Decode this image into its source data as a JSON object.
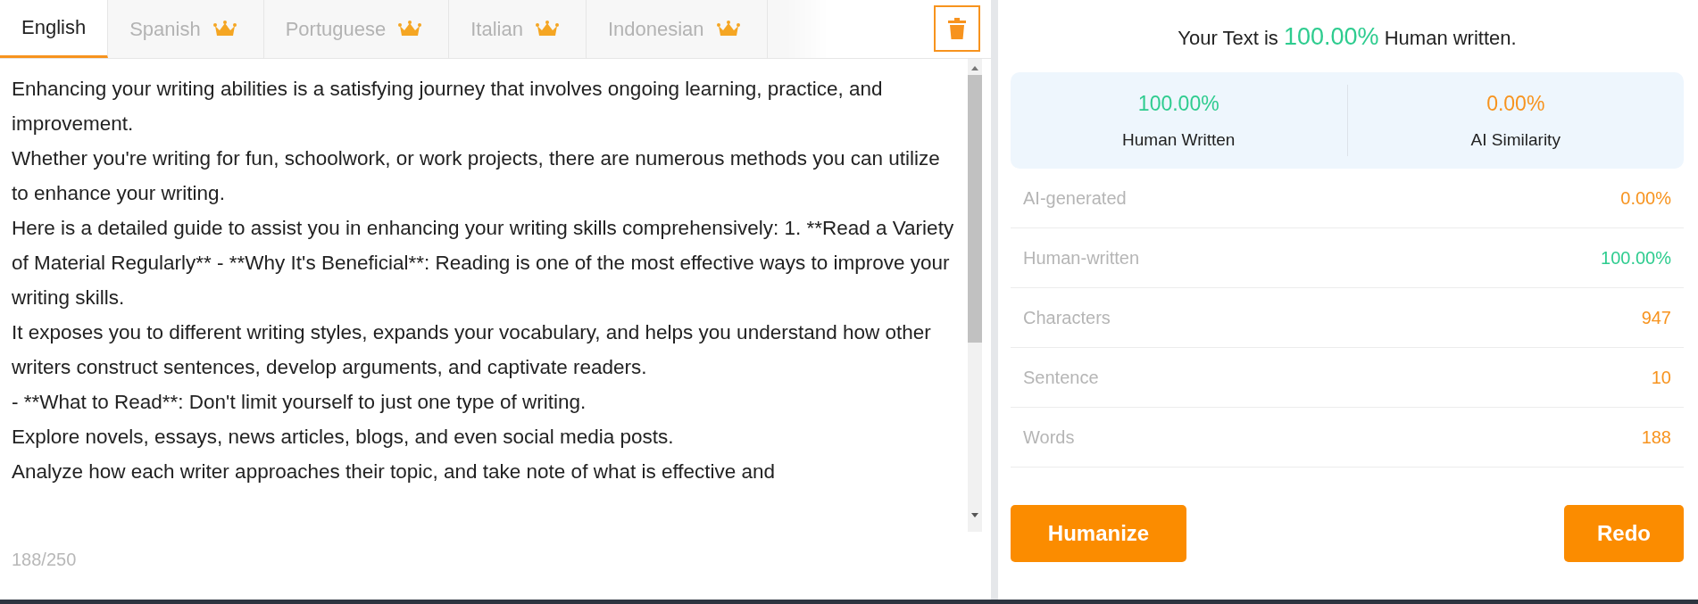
{
  "tabs": [
    {
      "label": "English",
      "selected": true,
      "premium": false
    },
    {
      "label": "Spanish",
      "selected": false,
      "premium": true
    },
    {
      "label": "Portuguese",
      "selected": false,
      "premium": true
    },
    {
      "label": "Italian",
      "selected": false,
      "premium": true
    },
    {
      "label": "Indonesian",
      "selected": false,
      "premium": true
    }
  ],
  "editor": {
    "paragraphs": [
      "Enhancing your writing abilities is a satisfying journey that involves ongoing learning, practice, and improvement.",
      "Whether you're writing for fun, schoolwork, or work projects, there are numerous methods you can utilize to enhance your writing.",
      "Here is a detailed guide to assist you in enhancing your writing skills comprehensively: 1. **Read a Variety of Material Regularly** - **Why It's Beneficial**: Reading is one of the most effective ways to improve your writing skills.",
      "It exposes you to different writing styles, expands your vocabulary, and helps you understand how other writers construct sentences, develop arguments, and captivate readers.",
      "- **What to Read**: Don't limit yourself to just one type of writing.",
      "Explore novels, essays, news articles, blogs, and even social media posts.",
      "Analyze how each writer approaches their topic, and take note of what is effective and"
    ],
    "counter": "188/250"
  },
  "results": {
    "headline": "Your Text is **100.00%** Human written.",
    "summary": [
      {
        "value": "100.00%",
        "label": "Human Written",
        "color": "#2ecc8f"
      },
      {
        "value": "0.00%",
        "label": "AI Similarity",
        "color": "#f7931e"
      }
    ],
    "stats": [
      {
        "label": "AI-generated",
        "value": "0.00%",
        "color": "#f7931e"
      },
      {
        "label": "Human-written",
        "value": "100.00%",
        "color": "#2ecc8f"
      },
      {
        "label": "Characters",
        "value": "947",
        "color": "#f7931e"
      },
      {
        "label": "Sentence",
        "value": "10",
        "color": "#f7931e"
      },
      {
        "label": "Words",
        "value": "188",
        "color": "#f7931e"
      }
    ],
    "buttons": [
      "Humanize",
      "Redo"
    ]
  }
}
